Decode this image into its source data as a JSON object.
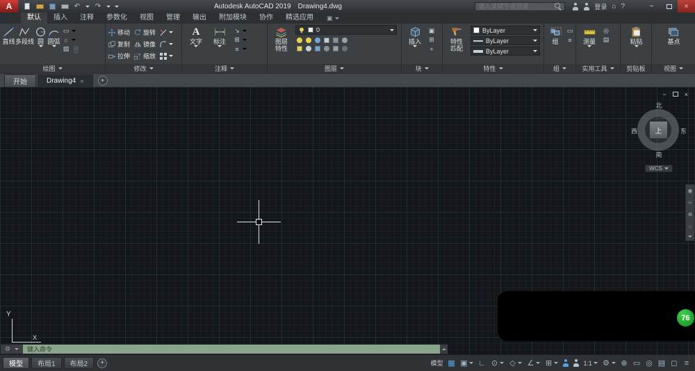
{
  "titlebar": {
    "logo_letter": "A",
    "app_title": "Autodesk AutoCAD 2019",
    "doc_title": "Drawing4.dwg",
    "search_placeholder": "键入关键字或短语",
    "signin_label": "登录"
  },
  "ribbon_tabs": [
    {
      "label": "默认"
    },
    {
      "label": "插入"
    },
    {
      "label": "注释"
    },
    {
      "label": "参数化"
    },
    {
      "label": "视图"
    },
    {
      "label": "管理"
    },
    {
      "label": "输出"
    },
    {
      "label": "附加模块"
    },
    {
      "label": "协作"
    },
    {
      "label": "精选应用"
    }
  ],
  "panels": {
    "draw": {
      "label": "绘图",
      "line": "直线",
      "polyline": "多段线",
      "circle": "圆",
      "arc": "圆弧"
    },
    "modify": {
      "label": "修改",
      "move": "移动",
      "rotate": "旋转",
      "copy": "复制",
      "mirror": "镜像",
      "stretch": "拉伸",
      "scale": "缩放"
    },
    "annotate": {
      "label": "注释",
      "text": "文字",
      "dimension": "标注"
    },
    "layers": {
      "label": "图层",
      "properties_btn": "图层特性",
      "current_layer": "0"
    },
    "block": {
      "label": "块",
      "insert": "插入"
    },
    "properties": {
      "label": "特性",
      "match": "特性匹配",
      "color_value": "ByLayer",
      "linetype_value": "ByLayer",
      "lineweight_value": "ByLayer"
    },
    "groups": {
      "label": "组",
      "group_btn": "组"
    },
    "utilities": {
      "label": "实用工具",
      "measure": "测量"
    },
    "clipboard": {
      "label": "剪贴板",
      "paste": "粘贴"
    },
    "view": {
      "label": "视图",
      "base": "基点"
    }
  },
  "file_tabs": {
    "start": "开始",
    "active_doc": "Drawing4"
  },
  "canvas": {
    "viewcube": {
      "north": "北",
      "south": "南",
      "west": "西",
      "east": "东",
      "top_face": "上",
      "wcs_label": "WCS"
    },
    "axis_x": "X",
    "axis_y": "Y",
    "command_placeholder": "键入命令",
    "badge_value": "76"
  },
  "bottom_bar": {
    "model_tab": "模型",
    "layout1_tab": "布局1",
    "layout2_tab": "布局2",
    "model_space": "模型",
    "annotation_scale": "1:1"
  },
  "icons": {
    "text_tool": "A",
    "undo": "↶",
    "redo": "↷",
    "minimize": "−",
    "close": "×",
    "plus": "+",
    "help": "?",
    "home": "⌂",
    "grid": "▦",
    "snap": "▣",
    "ortho": "∟",
    "polar": "⊙",
    "isodraft": "◇",
    "track": "∠",
    "osnap": "⊞",
    "workspace_gear": "⚙",
    "monitor": "⊕",
    "quick_props": "▭",
    "isolate": "◎",
    "hardware": "▤",
    "fullscreen": "◻",
    "customize": "≡",
    "rect_tool": "▭",
    "ellipse_tool": "○",
    "hatch_tool": "▨",
    "gradient_tool": "░",
    "leader_tool": "↘",
    "table_tool": "⊞",
    "style_tool": "≡",
    "nav_wheel": "◉",
    "nav_pan": "⊹",
    "nav_zoom": "⊕",
    "nav_orbit": "○"
  },
  "colors": {
    "active_blue": "#4da6e8",
    "badge_green": "#1fa32a",
    "command_green": "#91ad93",
    "logo_red": "#c03030"
  }
}
